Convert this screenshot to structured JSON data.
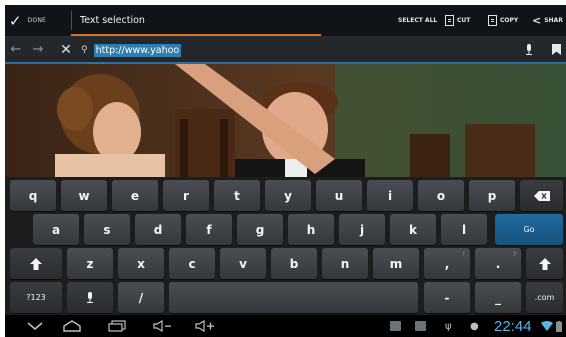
{
  "action_bar": {
    "done_label": "DONE",
    "title": "Text selection",
    "select_all": "SELECT ALL",
    "cut": "CUT",
    "copy": "COPY",
    "share": "SHAR"
  },
  "url_bar": {
    "url_text": "http://www.yahoo"
  },
  "keyboard": {
    "row1": [
      "q",
      "w",
      "e",
      "r",
      "t",
      "y",
      "u",
      "i",
      "o",
      "p"
    ],
    "row2": [
      "a",
      "s",
      "d",
      "f",
      "g",
      "h",
      "j",
      "k",
      "l"
    ],
    "row3": [
      "z",
      "x",
      "c",
      "v",
      "b",
      "n",
      "m"
    ],
    "row3_punct": [
      ",",
      "."
    ],
    "row3_sub": [
      "!",
      "?"
    ],
    "go": "Go",
    "num_key": "?123",
    "slash": "/",
    "dash": "-",
    "underscore": "_",
    "dotcom": ".com",
    "backspace_icon": "backspace-icon",
    "shift_icon": "shift-icon",
    "mic_icon": "mic-icon"
  },
  "system_bar": {
    "clock": "22:44"
  },
  "colors": {
    "accent_orange": "#d9741f",
    "accent_blue": "#2f6f9f",
    "clock_blue": "#58b4e9"
  }
}
